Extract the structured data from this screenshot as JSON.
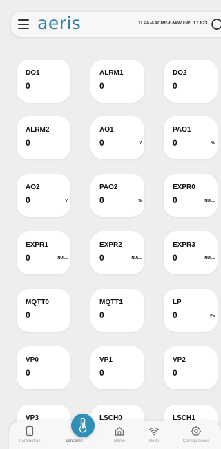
{
  "header": {
    "logo_text": "aeris",
    "firmware_text": "TLPA-AACRR-E-WW FW: 0.1.823",
    "menu_icon": "hamburger-menu-icon",
    "refresh_icon": "refresh-icon"
  },
  "colors": {
    "brand": "#2e7fa6",
    "active_button": "#2f8fb4",
    "background": "#eeeeee",
    "card": "#ffffff"
  },
  "cards": [
    {
      "name": "DO1",
      "value": "0",
      "unit": ""
    },
    {
      "name": "ALRM1",
      "value": "0",
      "unit": ""
    },
    {
      "name": "DO2",
      "value": "0",
      "unit": ""
    },
    {
      "name": "ALRM2",
      "value": "0",
      "unit": ""
    },
    {
      "name": "AO1",
      "value": "0",
      "unit": "V"
    },
    {
      "name": "PAO1",
      "value": "0",
      "unit": "%"
    },
    {
      "name": "AO2",
      "value": "0",
      "unit": "V"
    },
    {
      "name": "PAO2",
      "value": "0",
      "unit": "%"
    },
    {
      "name": "EXPR0",
      "value": "0",
      "unit": "NULL"
    },
    {
      "name": "EXPR1",
      "value": "0",
      "unit": "NULL"
    },
    {
      "name": "EXPR2",
      "value": "0",
      "unit": "NULL"
    },
    {
      "name": "EXPR3",
      "value": "0",
      "unit": "NULL"
    },
    {
      "name": "MQTT0",
      "value": "0",
      "unit": ""
    },
    {
      "name": "MQTT1",
      "value": "0",
      "unit": ""
    },
    {
      "name": "LP",
      "value": "0",
      "unit": "Pa"
    },
    {
      "name": "VP0",
      "value": "0",
      "unit": ""
    },
    {
      "name": "VP1",
      "value": "0",
      "unit": ""
    },
    {
      "name": "VP2",
      "value": "0",
      "unit": ""
    },
    {
      "name": "VP3",
      "value": "",
      "unit": ""
    },
    {
      "name": "LSCH0",
      "value": "",
      "unit": ""
    },
    {
      "name": "LSCH1",
      "value": "",
      "unit": ""
    }
  ],
  "nav": {
    "items": [
      {
        "label": "Parâmetros",
        "icon": "tablet-icon"
      },
      {
        "label": "Sensores",
        "icon": "thermometer-icon",
        "active": true
      },
      {
        "label": "Home",
        "icon": "home-icon"
      },
      {
        "label": "Rede",
        "icon": "wifi-icon"
      },
      {
        "label": "Configurações",
        "icon": "gear-icon"
      }
    ]
  }
}
